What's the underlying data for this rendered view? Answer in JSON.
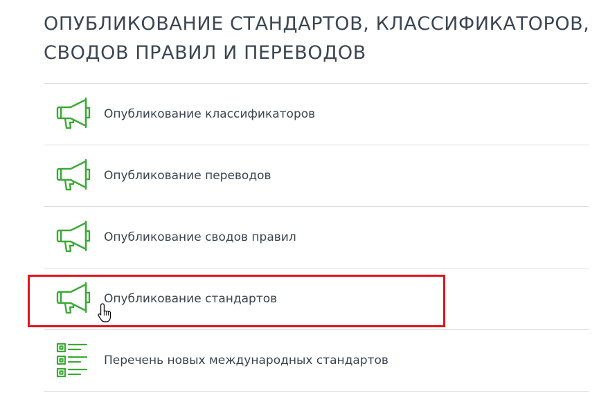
{
  "header": {
    "title": "ОПУБЛИКОВАНИЕ СТАНДАРТОВ, КЛАССИФИКАТОРОВ, СВОДОВ ПРАВИЛ И ПЕРЕВОДОВ"
  },
  "menu": {
    "items": [
      {
        "label": "Опубликование классификаторов",
        "icon": "megaphone-icon"
      },
      {
        "label": "Опубликование переводов",
        "icon": "megaphone-icon"
      },
      {
        "label": "Опубликование сводов правил",
        "icon": "megaphone-icon"
      },
      {
        "label": "Опубликование стандартов",
        "icon": "megaphone-icon",
        "highlighted": true,
        "hovered": true
      },
      {
        "label": "Перечень новых международных стандартов",
        "icon": "checklist-icon"
      }
    ]
  },
  "colors": {
    "icon_green": "#3aaa35",
    "highlight_red": "#e0141b",
    "text": "#3a4450",
    "divider": "#dedede"
  }
}
